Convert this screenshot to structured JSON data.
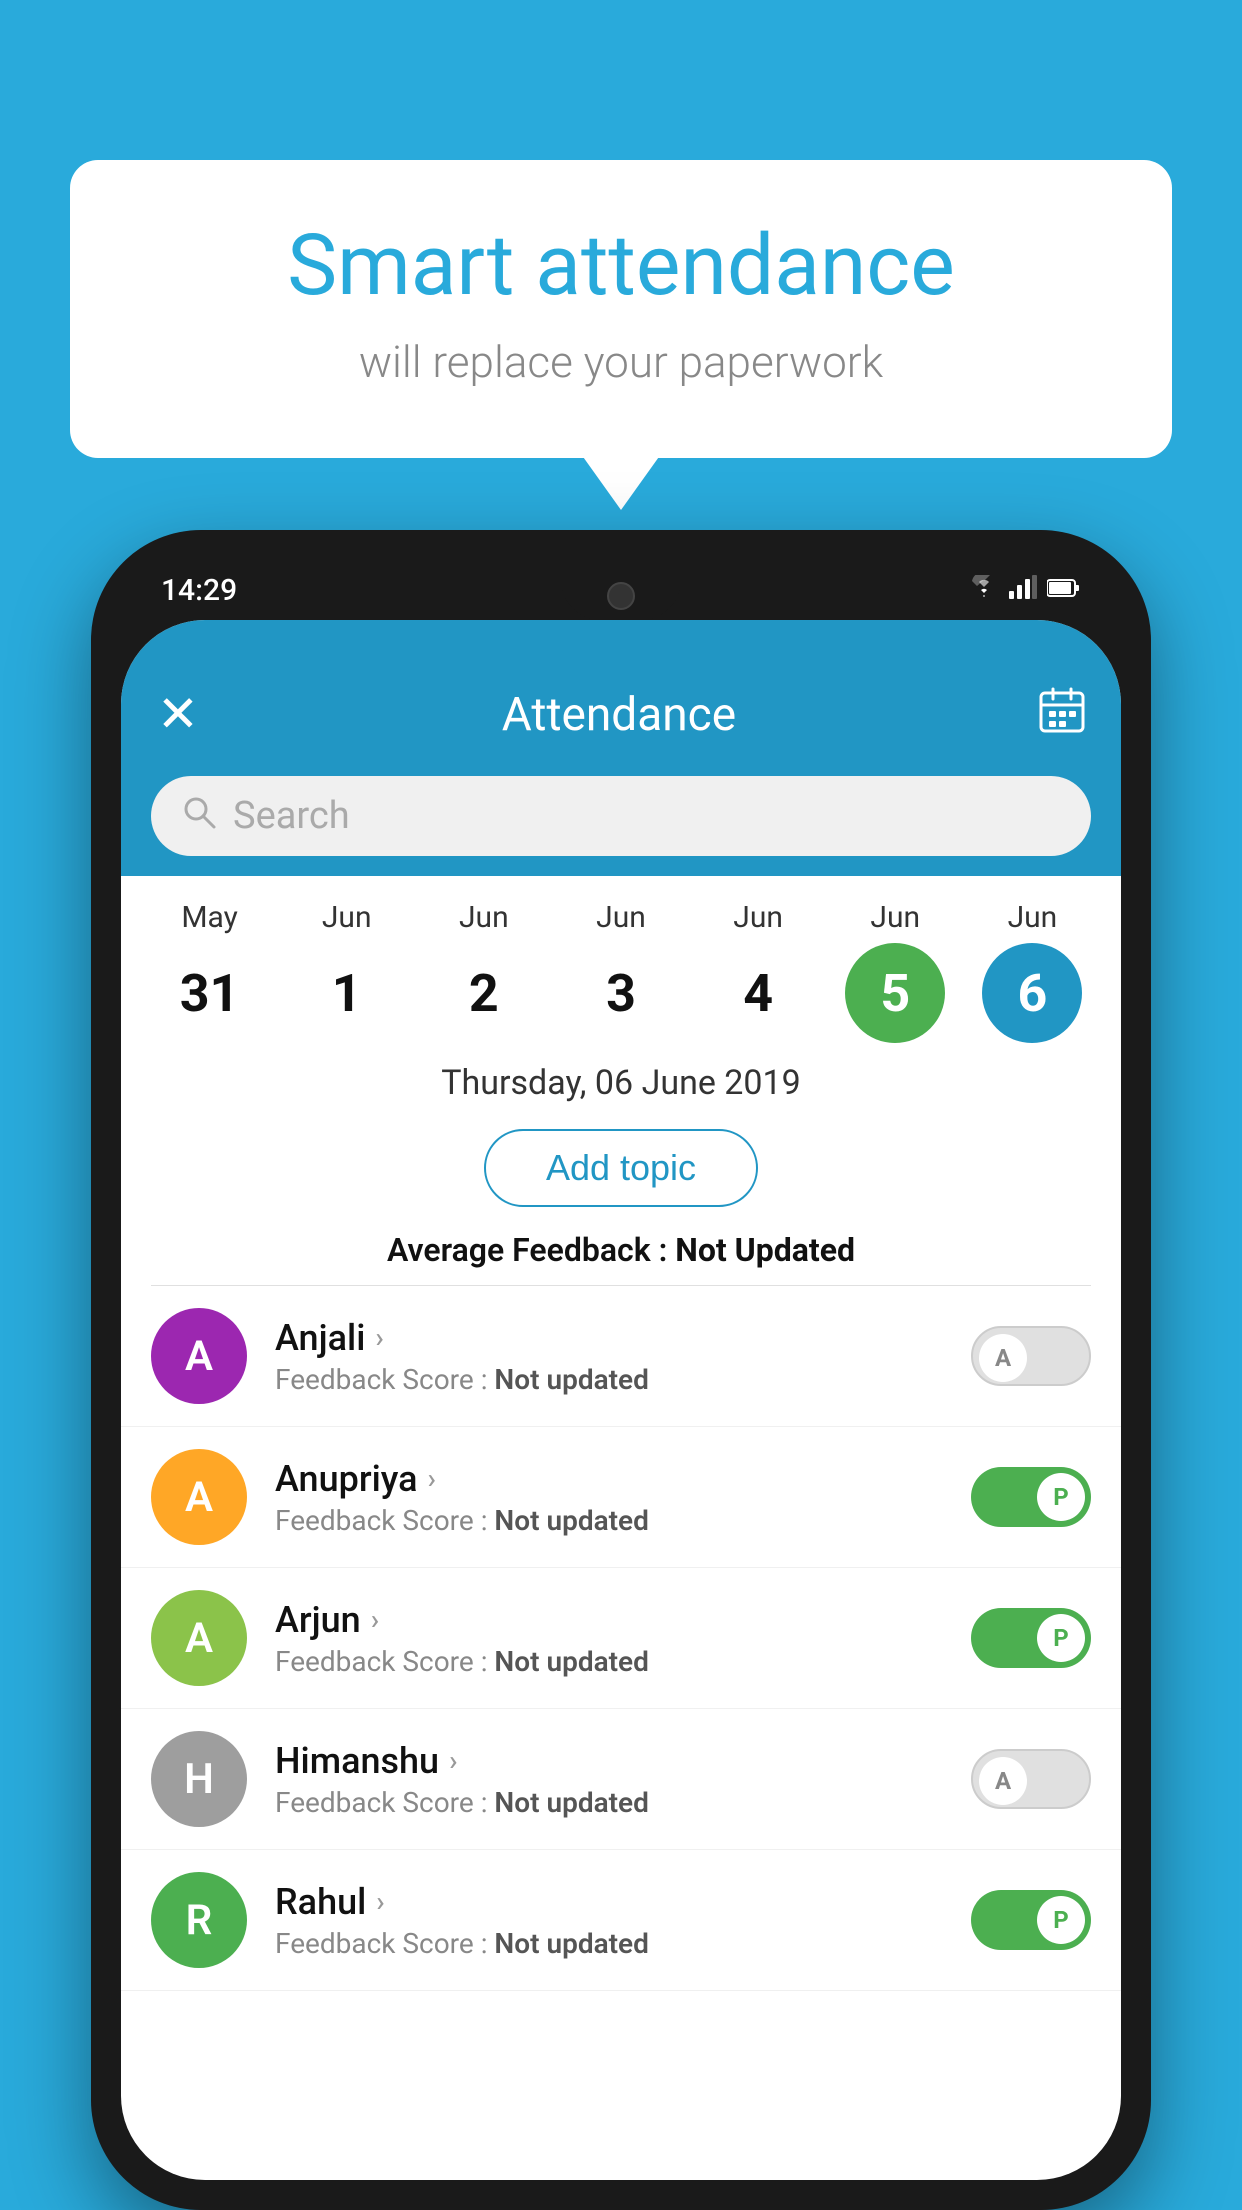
{
  "background": {
    "color": "#29AADB"
  },
  "bubble": {
    "title": "Smart attendance",
    "subtitle": "will replace your paperwork"
  },
  "status_bar": {
    "time": "14:29",
    "wifi": "▼",
    "signal": "▲",
    "battery": "▮"
  },
  "app_bar": {
    "close_label": "✕",
    "title": "Attendance",
    "calendar_icon": "📅"
  },
  "search": {
    "placeholder": "Search"
  },
  "calendar": {
    "dates": [
      {
        "month": "May",
        "day": "31",
        "state": "normal"
      },
      {
        "month": "Jun",
        "day": "1",
        "state": "normal"
      },
      {
        "month": "Jun",
        "day": "2",
        "state": "normal"
      },
      {
        "month": "Jun",
        "day": "3",
        "state": "normal"
      },
      {
        "month": "Jun",
        "day": "4",
        "state": "normal"
      },
      {
        "month": "Jun",
        "day": "5",
        "state": "today"
      },
      {
        "month": "Jun",
        "day": "6",
        "state": "selected"
      }
    ],
    "selected_label": "Thursday, 06 June 2019"
  },
  "add_topic": {
    "label": "Add topic"
  },
  "avg_feedback": {
    "label_prefix": "Average Feedback : ",
    "label_value": "Not Updated"
  },
  "students": [
    {
      "name": "Anjali",
      "avatar_letter": "A",
      "avatar_color": "#9C27B0",
      "feedback": "Feedback Score : ",
      "feedback_value": "Not updated",
      "status": "absent"
    },
    {
      "name": "Anupriya",
      "avatar_letter": "A",
      "avatar_color": "#FFA726",
      "feedback": "Feedback Score : ",
      "feedback_value": "Not updated",
      "status": "present"
    },
    {
      "name": "Arjun",
      "avatar_letter": "A",
      "avatar_color": "#8BC34A",
      "feedback": "Feedback Score : ",
      "feedback_value": "Not updated",
      "status": "present"
    },
    {
      "name": "Himanshu",
      "avatar_letter": "H",
      "avatar_color": "#9E9E9E",
      "feedback": "Feedback Score : ",
      "feedback_value": "Not updated",
      "status": "absent"
    },
    {
      "name": "Rahul",
      "avatar_letter": "R",
      "avatar_color": "#4CAF50",
      "feedback": "Feedback Score : ",
      "feedback_value": "Not updated",
      "status": "present"
    }
  ]
}
